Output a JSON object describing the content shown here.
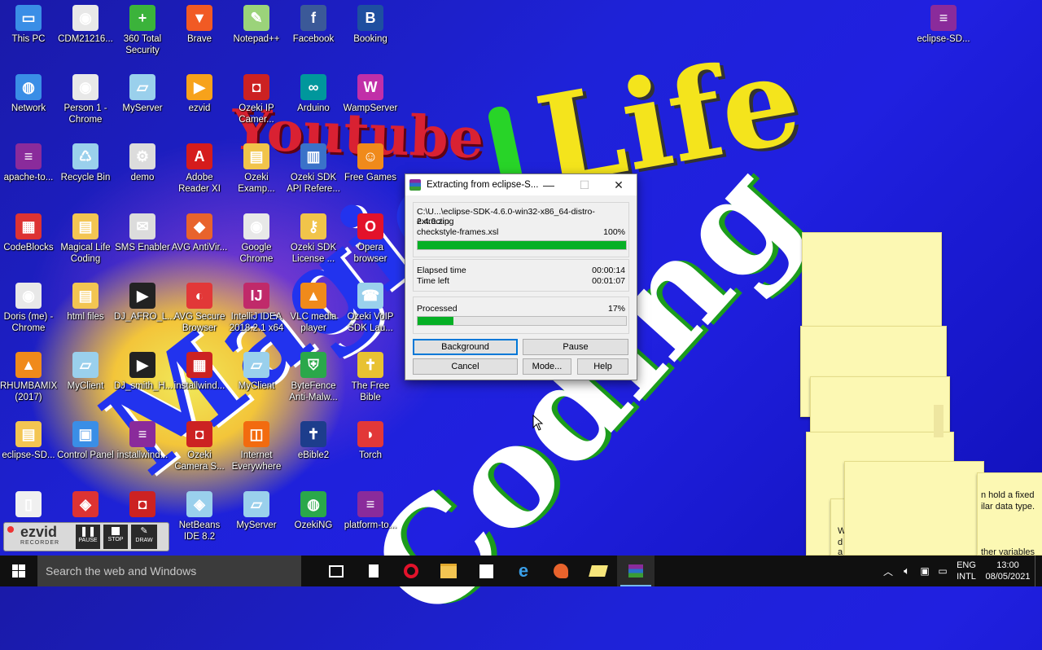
{
  "desktop_icons": [
    {
      "label": "This PC",
      "glyph": "computer-icon",
      "color": "#3a8ee6",
      "symbol": "▭"
    },
    {
      "label": "CDM21216...",
      "glyph": "cdm-installer-icon",
      "color": "#e8e8e8",
      "symbol": "◉"
    },
    {
      "label": "360 Total Security",
      "glyph": "shield-plus-icon",
      "color": "#3bb33b",
      "symbol": "+"
    },
    {
      "label": "Brave",
      "glyph": "brave-lion-icon",
      "color": "#f15a24",
      "symbol": "▼"
    },
    {
      "label": "Notepad++",
      "glyph": "notepad-icon",
      "color": "#9bd37a",
      "symbol": "✎"
    },
    {
      "label": "Facebook",
      "glyph": "facebook-icon",
      "color": "#3b5998",
      "symbol": "f"
    },
    {
      "label": "Booking",
      "glyph": "booking-icon",
      "color": "#1e4fa0",
      "symbol": "B"
    },
    {
      "label": "Network",
      "glyph": "network-globe-icon",
      "color": "#3a8ee6",
      "symbol": "◍"
    },
    {
      "label": "Person 1 - Chrome",
      "glyph": "chrome-icon",
      "color": "#e8e8e8",
      "symbol": "◉"
    },
    {
      "label": "MyServer",
      "glyph": "server-icon",
      "color": "#9ad0ec",
      "symbol": "▱"
    },
    {
      "label": "ezvid",
      "glyph": "ezvid-play-icon",
      "color": "#f7a21b",
      "symbol": "▶"
    },
    {
      "label": "Ozeki IP Camer...",
      "glyph": "camera-icon",
      "color": "#c22",
      "symbol": "◘"
    },
    {
      "label": "Arduino",
      "glyph": "arduino-icon",
      "color": "#00979c",
      "symbol": "∞"
    },
    {
      "label": "WampServer",
      "glyph": "wamp-icon",
      "color": "#c12fa8",
      "symbol": "W"
    },
    {
      "label": "apache-to...",
      "glyph": "winrar-archive-icon",
      "color": "#8a2b9b",
      "symbol": "≡"
    },
    {
      "label": "Recycle Bin",
      "glyph": "recycle-bin-icon",
      "color": "#9ad0ec",
      "symbol": "♺"
    },
    {
      "label": "demo",
      "glyph": "settings-icon",
      "color": "#dcdcdc",
      "symbol": "⚙"
    },
    {
      "label": "Adobe Reader XI",
      "glyph": "adobe-pdf-icon",
      "color": "#d51c1c",
      "symbol": "A"
    },
    {
      "label": "Ozeki Examp...",
      "glyph": "folder-red-icon",
      "color": "#f1c44a",
      "symbol": "▤"
    },
    {
      "label": "Ozeki SDK API Refere...",
      "glyph": "book-icon",
      "color": "#3a72c9",
      "symbol": "▥"
    },
    {
      "label": "Free Games",
      "glyph": "games-icon",
      "color": "#f08a1b",
      "symbol": "☺"
    },
    {
      "label": "CodeBlocks",
      "glyph": "codeblocks-icon",
      "color": "#d33",
      "symbol": "▦"
    },
    {
      "label": "Magical Life Coding",
      "glyph": "folder-icon",
      "color": "#f3c552",
      "symbol": "▤"
    },
    {
      "label": "SMS Enabler",
      "glyph": "sms-icon",
      "color": "#dcdcdc",
      "symbol": "✉"
    },
    {
      "label": "AVG AntiVir...",
      "glyph": "avg-icon",
      "color": "#e8632c",
      "symbol": "◆"
    },
    {
      "label": "Google Chrome",
      "glyph": "chrome-icon",
      "color": "#e8e8e8",
      "symbol": "◉"
    },
    {
      "label": "Ozeki SDK License ...",
      "glyph": "key-icon",
      "color": "#f1c44a",
      "symbol": "⚷"
    },
    {
      "label": "Opera browser",
      "glyph": "opera-icon",
      "color": "#e3122b",
      "symbol": "O"
    },
    {
      "label": "Doris (me) - Chrome",
      "glyph": "chrome-icon",
      "color": "#e8e8e8",
      "symbol": "◉"
    },
    {
      "label": "html files",
      "glyph": "html-file-icon",
      "color": "#f3c552",
      "symbol": "▤"
    },
    {
      "label": "DJ_AFRO_L...",
      "glyph": "video-file-icon",
      "color": "#222",
      "symbol": "▶"
    },
    {
      "label": "AVG Secure Browser",
      "glyph": "avg-browser-icon",
      "color": "#e23838",
      "symbol": "◐"
    },
    {
      "label": "IntelliJ IDEA 2018.2.1 x64",
      "glyph": "intellij-icon",
      "color": "#c02a6a",
      "symbol": "IJ"
    },
    {
      "label": "VLC media player",
      "glyph": "vlc-icon",
      "color": "#f08a1b",
      "symbol": "▲"
    },
    {
      "label": "Ozeki VoIP SDK Lau...",
      "glyph": "phone-icon",
      "color": "#9ad0ec",
      "symbol": "☎"
    },
    {
      "label": "RHUMBAMIX (2017)",
      "glyph": "vlc-icon",
      "color": "#f08a1b",
      "symbol": "▲"
    },
    {
      "label": "MyClient",
      "glyph": "client-icon",
      "color": "#9ad0ec",
      "symbol": "▱"
    },
    {
      "label": "DJ_smith_H...",
      "glyph": "video-file-icon",
      "color": "#222",
      "symbol": "▶"
    },
    {
      "label": "installwind...",
      "glyph": "grid-app-icon",
      "color": "#c22",
      "symbol": "▦"
    },
    {
      "label": "MyClient",
      "glyph": "client-icon",
      "color": "#9ad0ec",
      "symbol": "▱"
    },
    {
      "label": "ByteFence Anti-Malw...",
      "glyph": "bytefence-shield-icon",
      "color": "#2aa84a",
      "symbol": "⛨"
    },
    {
      "label": "The Free Bible",
      "glyph": "bible-icon",
      "color": "#e8c232",
      "symbol": "✝"
    },
    {
      "label": "eclipse-SD...",
      "glyph": "zip-folder-icon",
      "color": "#f3c552",
      "symbol": "▤"
    },
    {
      "label": "Control Panel",
      "glyph": "control-panel-icon",
      "color": "#3a8ee6",
      "symbol": "▣"
    },
    {
      "label": "installwind...",
      "glyph": "winrar-archive-icon",
      "color": "#8a2b9b",
      "symbol": "≡"
    },
    {
      "label": "Ozeki Camera S...",
      "glyph": "camera-icon",
      "color": "#c22",
      "symbol": "◘"
    },
    {
      "label": "Internet Everywhere",
      "glyph": "internet-everywhere-icon",
      "color": "#f26b0f",
      "symbol": "◫"
    },
    {
      "label": "eBible2",
      "glyph": "bible-icon",
      "color": "#1d3d8c",
      "symbol": "✝"
    },
    {
      "label": "Torch",
      "glyph": "torch-icon",
      "color": "#e23838",
      "symbol": "◗"
    },
    {
      "label": "",
      "glyph": "document-icon",
      "color": "#f0f0f0",
      "symbol": "▯"
    },
    {
      "label": "",
      "glyph": "cube-app-icon",
      "color": "#d33",
      "symbol": "◈"
    },
    {
      "label": "",
      "glyph": "camera-icon",
      "color": "#c22",
      "symbol": "◘"
    },
    {
      "label": "NetBeans IDE 8.2",
      "glyph": "netbeans-cube-icon",
      "color": "#9ad0ec",
      "symbol": "◈"
    },
    {
      "label": "MyServer",
      "glyph": "server-icon",
      "color": "#9ad0ec",
      "symbol": "▱"
    },
    {
      "label": "OzekiNG",
      "glyph": "globe-phone-icon",
      "color": "#2aa84a",
      "symbol": "◍"
    },
    {
      "label": "platform-to...",
      "glyph": "winrar-archive-icon",
      "color": "#8a2b9b",
      "symbol": "≡"
    },
    {
      "label": "eclipse-SD...",
      "glyph": "winrar-archive-icon",
      "color": "#8a2b9b",
      "symbol": "≡"
    }
  ],
  "wallpaper": {
    "youtube": "Youtube",
    "magic": "Magic",
    "life": "Life",
    "coding": "Coding"
  },
  "dialog": {
    "title": "Extracting from eclipse-S...",
    "archive_path": "C:\\U...\\eclipse-SDK-4.6.0-win32-x86_64-distro-2.4.0.zip",
    "action": "extracting",
    "current_file": "checkstyle-frames.xsl",
    "file_percent_label": "100%",
    "file_progress": 1.0,
    "elapsed_label": "Elapsed time",
    "elapsed_value": "00:00:14",
    "left_label": "Time left",
    "left_value": "00:01:07",
    "processed_label": "Processed",
    "processed_percent_label": "17%",
    "processed_progress": 0.17,
    "buttons": {
      "background": "Background",
      "pause": "Pause",
      "cancel": "Cancel",
      "mode": "Mode...",
      "help": "Help"
    },
    "controls": {
      "minimize": "—",
      "maximize": "☐",
      "close": "✕"
    }
  },
  "sticky_notes": {
    "line1": "n hold a fixed",
    "line2": "ilar data type.",
    "line3": "ther variables",
    "frag_w": "W",
    "frag_d": "d",
    "frag_a": "a"
  },
  "ezvid": {
    "logo": "ezvid",
    "recorder": "RECORDER",
    "pause": "PAUSE",
    "stop": "STOP",
    "draw": "DRAW"
  },
  "taskbar": {
    "search_placeholder": "Search the web and Windows",
    "apps": [
      "task-view-icon",
      "notepad-file-icon",
      "opera-icon",
      "file-explorer-icon",
      "store-icon",
      "edge-icon",
      "media-app-icon",
      "sticky-notes-icon",
      "winrar-icon"
    ],
    "language_top": "ENG",
    "language_bottom": "INTL",
    "time": "13:00",
    "date": "08/05/2021"
  }
}
